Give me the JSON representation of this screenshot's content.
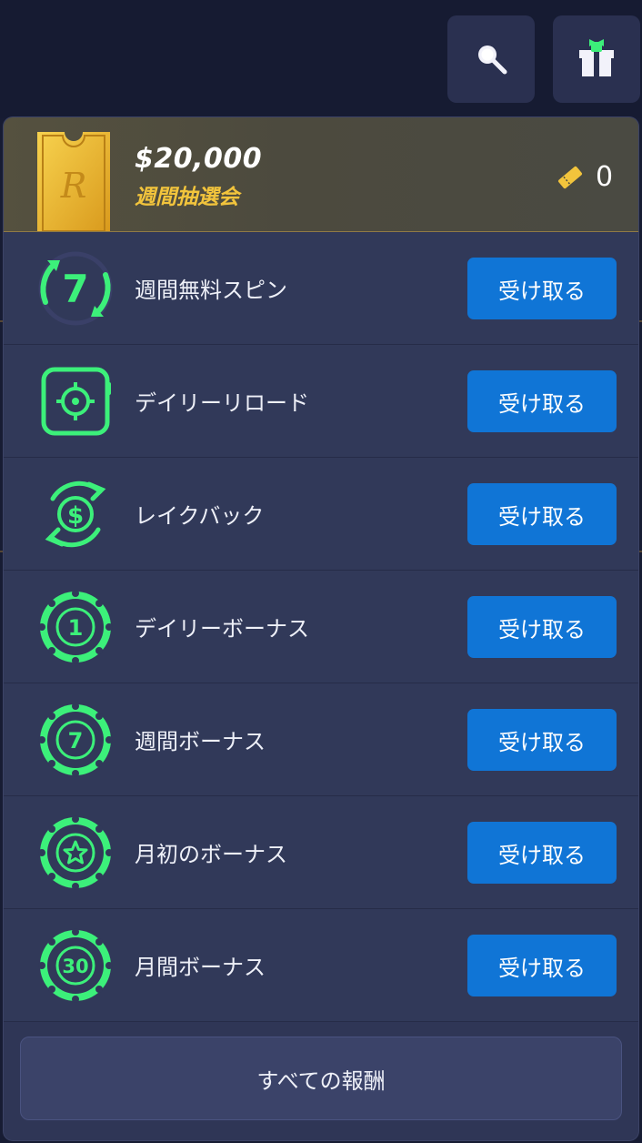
{
  "header": {
    "search_icon": "search-icon",
    "gift_icon": "gift-icon"
  },
  "lottery": {
    "amount": "$20,000",
    "title": "週間抽選会",
    "ticket_count": "0"
  },
  "rewards": [
    {
      "icon": "free-spin-7-icon",
      "label": "週間無料スピン",
      "button": "受け取る"
    },
    {
      "icon": "daily-reload-target-icon",
      "label": "デイリーリロード",
      "button": "受け取る"
    },
    {
      "icon": "rakeback-dollar-icon",
      "label": "レイクバック",
      "button": "受け取る"
    },
    {
      "icon": "chip-1-icon",
      "label": "デイリーボーナス",
      "button": "受け取る"
    },
    {
      "icon": "chip-7-icon",
      "label": "週間ボーナス",
      "button": "受け取る"
    },
    {
      "icon": "chip-star-icon",
      "label": "月初のボーナス",
      "button": "受け取る"
    },
    {
      "icon": "chip-30-icon",
      "label": "月間ボーナス",
      "button": "受け取る"
    }
  ],
  "footer": {
    "all_rewards_label": "すべての報酬"
  },
  "colors": {
    "accent_green": "#3cf07a",
    "claim_blue": "#1075d6",
    "gold": "#f2c43c"
  },
  "chip_labels": {
    "chip1": "1",
    "chip7": "7",
    "chip30": "30",
    "spin7": "7"
  }
}
